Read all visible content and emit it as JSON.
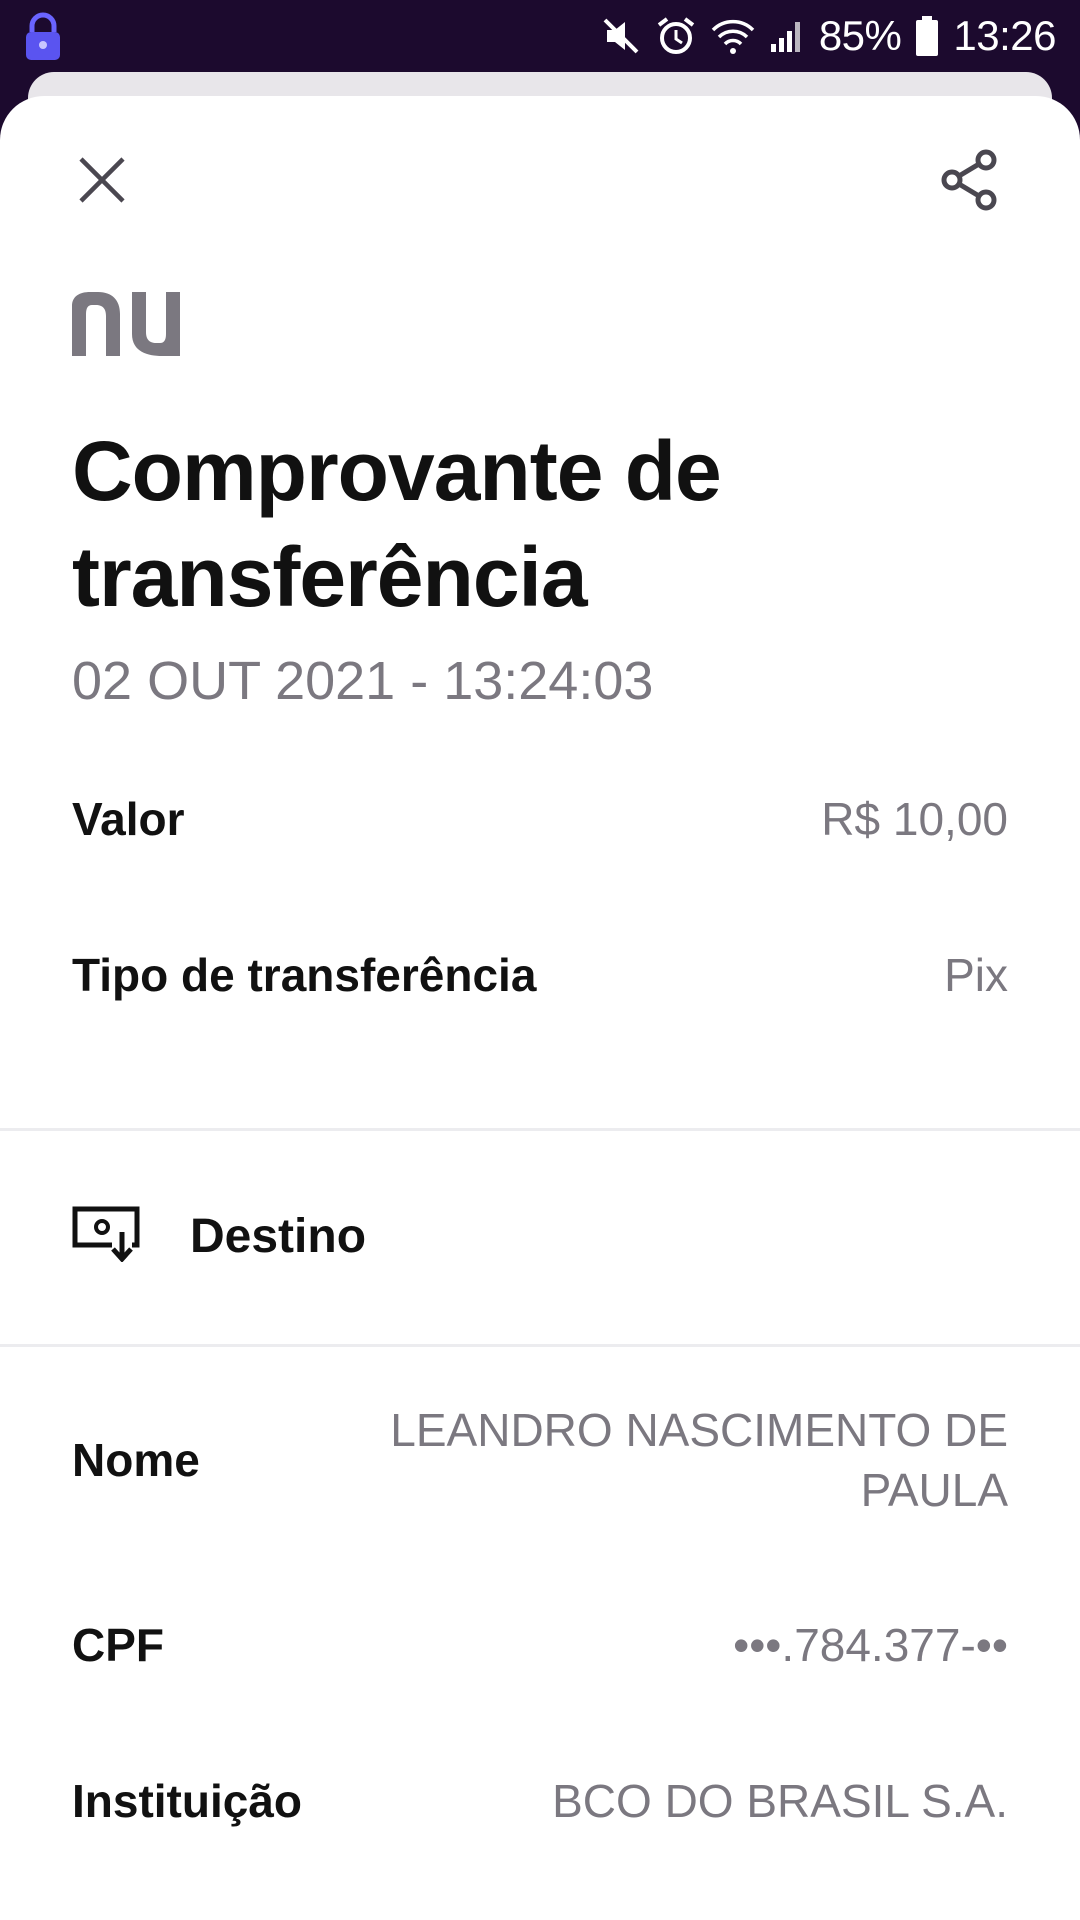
{
  "status_bar": {
    "battery": "85%",
    "time": "13:26"
  },
  "header": {
    "title_line1": "Comprovante de",
    "title_line2": "transferência",
    "datetime": "02 OUT 2021 - 13:24:03"
  },
  "details": {
    "valor_label": "Valor",
    "valor_value": "R$ 10,00",
    "tipo_label": "Tipo de transferência",
    "tipo_value": "Pix"
  },
  "destino": {
    "section_label": "Destino",
    "nome_label": "Nome",
    "nome_value": "LEANDRO NASCIMENTO DE PAULA",
    "cpf_label": "CPF",
    "cpf_value": "•••.784.377-••",
    "instituicao_label": "Instituição",
    "instituicao_value": "BCO DO BRASIL S.A."
  },
  "icons": {
    "close": "close-icon",
    "share": "share-icon",
    "destino": "cash-receive-icon",
    "logo": "nu-logo"
  },
  "colors": {
    "status_bar_bg": "#1c0a2e",
    "primary_text": "#111111",
    "secondary_text": "#7b7880",
    "logo": "#7b7880"
  }
}
